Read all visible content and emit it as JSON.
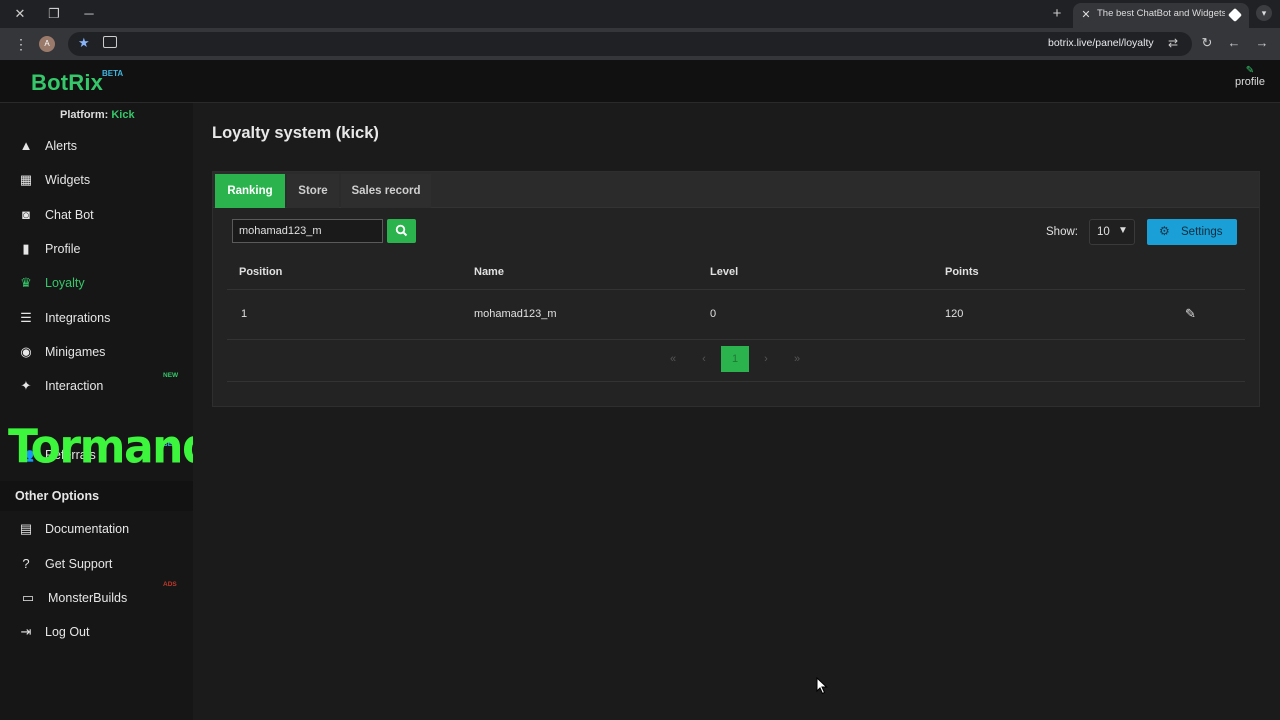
{
  "browser": {
    "tab_title": "The best ChatBot and Widgets",
    "url": "botrix.live/panel/loyalty",
    "account_initial": "A",
    "window_controls": [
      "close-icon",
      "restore-icon",
      "minimize-icon"
    ]
  },
  "brand": {
    "name": "BotRix",
    "badge": "BETA",
    "color": "#35c76a"
  },
  "profile_link": {
    "label": "profile"
  },
  "platform": {
    "prefix": "Platform:",
    "value": "Kick"
  },
  "sidebar": {
    "items": [
      {
        "label": "Alerts",
        "icon": "warning-icon"
      },
      {
        "label": "Widgets",
        "icon": "table-icon"
      },
      {
        "label": "Chat Bot",
        "icon": "robot-icon"
      },
      {
        "label": "Profile",
        "icon": "user-icon"
      },
      {
        "label": "Loyalty",
        "icon": "trophy-icon",
        "active": true
      },
      {
        "label": "Integrations",
        "icon": "list-icon"
      },
      {
        "label": "Minigames",
        "icon": "gamepad-icon"
      },
      {
        "label": "Interaction",
        "icon": "interaction-icon",
        "badge": "NEW"
      },
      {
        "label": "Referrals",
        "icon": "users-icon",
        "badge": "BETA"
      }
    ],
    "other_title": "Other Options",
    "other_items": [
      {
        "label": "Documentation",
        "icon": "book-icon"
      },
      {
        "label": "Get Support",
        "icon": "question-icon"
      },
      {
        "label": "MonsterBuilds",
        "icon": "laptop-icon",
        "badge": "ADS"
      },
      {
        "label": "Log Out",
        "icon": "logout-icon"
      }
    ]
  },
  "overlay": {
    "text": "Tormando"
  },
  "main": {
    "title": "Loyalty system (kick)",
    "tabs": [
      {
        "label": "Ranking",
        "active": true
      },
      {
        "label": "Store"
      },
      {
        "label": "Sales record"
      }
    ],
    "search": {
      "value": "mohamad123_m",
      "placeholder": ""
    },
    "show": {
      "label": "Show:",
      "value": "10"
    },
    "settings_label": "Settings",
    "table": {
      "columns": [
        "Position",
        "Name",
        "Level",
        "Points"
      ],
      "rows": [
        {
          "position": "1",
          "name": "mohamad123_m",
          "level": "0",
          "points": "120"
        }
      ]
    },
    "pagination": {
      "first": "«",
      "prev": "‹",
      "current": "1",
      "next": "›",
      "last": "»"
    }
  },
  "colors": {
    "accent_green": "#2bb34e",
    "settings_blue": "#1a9fd6",
    "new_badge": "#35c76a",
    "beta_badge": "#3fb7e0",
    "ads_badge": "#c0392b"
  }
}
